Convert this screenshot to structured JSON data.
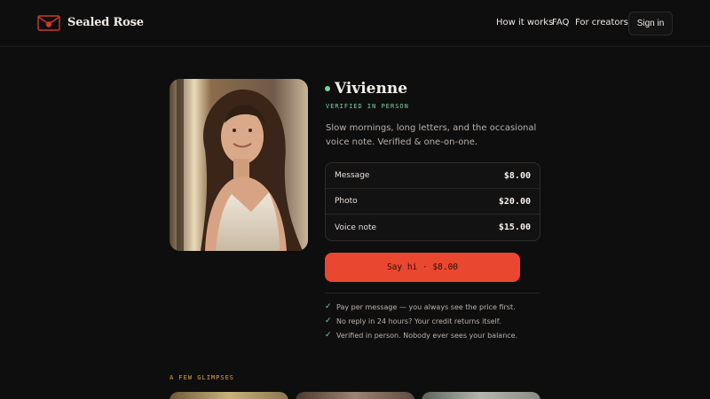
{
  "nav": {
    "brand": "Sealed Rose",
    "logo_icon": "sealed-envelope-icon",
    "links": [
      "How it works",
      "FAQ",
      "For creators"
    ],
    "signin": "Sign in"
  },
  "profile": {
    "name": "Vivienne",
    "online": true,
    "verified_label": "VERIFIED IN PERSON",
    "bio": "Slow mornings, long letters, and the occasional voice note. Verified & one-on-one.",
    "photo": "portrait-photo"
  },
  "pricing": [
    {
      "item": "Message",
      "price": "$8.00"
    },
    {
      "item": "Photo",
      "price": "$20.00"
    },
    {
      "item": "Voice note",
      "price": "$15.00"
    }
  ],
  "cta": {
    "label": "Say hi · $8.00"
  },
  "perks": [
    "Pay per message — you always see the price first.",
    "No reply in 24 hours? Your credit returns itself.",
    "Verified in person. Nobody ever sees your balance."
  ],
  "glimpses": {
    "title": "A FEW GLIMPSES",
    "count": 3
  },
  "colors": {
    "background": "#0f0e0e",
    "accent": "#ea4730",
    "verified_green": "#7fcfa3",
    "section_label": "#e0a14a"
  }
}
